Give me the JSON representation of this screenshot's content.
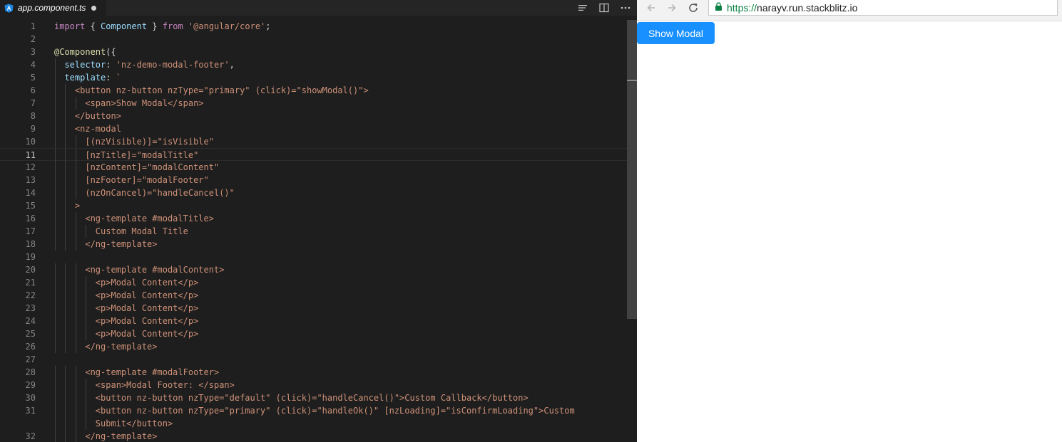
{
  "editor": {
    "tab": {
      "filename": "app.component.ts",
      "file_icon": "angular-icon",
      "dirty": true
    },
    "actions": [
      "outline-icon",
      "split-editor-icon",
      "more-icon"
    ],
    "lines": [
      {
        "n": "1",
        "tokens": [
          [
            "import",
            "kw"
          ],
          [
            " { ",
            "plain"
          ],
          [
            "Component",
            "cls"
          ],
          [
            " } ",
            "plain"
          ],
          [
            "from",
            "kw"
          ],
          [
            " ",
            "plain"
          ],
          [
            "'@angular/core'",
            "str"
          ],
          [
            ";",
            "plain"
          ]
        ]
      },
      {
        "n": "2",
        "tokens": []
      },
      {
        "n": "3",
        "tokens": [
          [
            "@Component",
            "dec"
          ],
          [
            "({",
            "plain"
          ]
        ]
      },
      {
        "n": "4",
        "tokens": [
          [
            "  ",
            "plain"
          ],
          [
            "selector",
            "cls"
          ],
          [
            ": ",
            "plain"
          ],
          [
            "'nz-demo-modal-footer'",
            "str"
          ],
          [
            ",",
            "plain"
          ]
        ]
      },
      {
        "n": "5",
        "tokens": [
          [
            "  ",
            "plain"
          ],
          [
            "template",
            "cls"
          ],
          [
            ": ",
            "plain"
          ],
          [
            "`",
            "str"
          ]
        ]
      },
      {
        "n": "6",
        "tokens": [
          [
            "    <button nz-button nzType=\"primary\" (click)=\"showModal()\">",
            "str"
          ]
        ]
      },
      {
        "n": "7",
        "tokens": [
          [
            "      <span>Show Modal</span>",
            "str"
          ]
        ]
      },
      {
        "n": "8",
        "tokens": [
          [
            "    </button>",
            "str"
          ]
        ]
      },
      {
        "n": "9",
        "tokens": [
          [
            "    <nz-modal",
            "str"
          ]
        ]
      },
      {
        "n": "10",
        "tokens": [
          [
            "      [(nzVisible)]=\"isVisible\"",
            "str"
          ]
        ]
      },
      {
        "n": "11",
        "tokens": [
          [
            "      [nzTitle]=\"modalTitle\"",
            "str"
          ]
        ],
        "current": true
      },
      {
        "n": "12",
        "tokens": [
          [
            "      [nzContent]=\"modalContent\"",
            "str"
          ]
        ]
      },
      {
        "n": "13",
        "tokens": [
          [
            "      [nzFooter]=\"modalFooter\"",
            "str"
          ]
        ]
      },
      {
        "n": "14",
        "tokens": [
          [
            "      (nzOnCancel)=\"handleCancel()\"",
            "str"
          ]
        ]
      },
      {
        "n": "15",
        "tokens": [
          [
            "    >",
            "str"
          ]
        ]
      },
      {
        "n": "16",
        "tokens": [
          [
            "      <ng-template #modalTitle>",
            "str"
          ]
        ]
      },
      {
        "n": "17",
        "tokens": [
          [
            "        Custom Modal Title",
            "str"
          ]
        ]
      },
      {
        "n": "18",
        "tokens": [
          [
            "      </ng-template>",
            "str"
          ]
        ]
      },
      {
        "n": "19",
        "tokens": []
      },
      {
        "n": "20",
        "tokens": [
          [
            "      <ng-template #modalContent>",
            "str"
          ]
        ]
      },
      {
        "n": "21",
        "tokens": [
          [
            "        <p>Modal Content</p>",
            "str"
          ]
        ]
      },
      {
        "n": "22",
        "tokens": [
          [
            "        <p>Modal Content</p>",
            "str"
          ]
        ]
      },
      {
        "n": "23",
        "tokens": [
          [
            "        <p>Modal Content</p>",
            "str"
          ]
        ]
      },
      {
        "n": "24",
        "tokens": [
          [
            "        <p>Modal Content</p>",
            "str"
          ]
        ]
      },
      {
        "n": "25",
        "tokens": [
          [
            "        <p>Modal Content</p>",
            "str"
          ]
        ]
      },
      {
        "n": "26",
        "tokens": [
          [
            "      </ng-template>",
            "str"
          ]
        ]
      },
      {
        "n": "27",
        "tokens": []
      },
      {
        "n": "28",
        "tokens": [
          [
            "      <ng-template #modalFooter>",
            "str"
          ]
        ]
      },
      {
        "n": "29",
        "tokens": [
          [
            "        <span>Modal Footer: </span>",
            "str"
          ]
        ]
      },
      {
        "n": "30",
        "tokens": [
          [
            "        <button nz-button nzType=\"default\" (click)=\"handleCancel()\">Custom Callback</button>",
            "str"
          ]
        ]
      },
      {
        "n": "31",
        "tokens": [
          [
            "        <button nz-button nzType=\"primary\" (click)=\"handleOk()\" [nzLoading]=\"isConfirmLoading\">Custom",
            "str"
          ]
        ]
      },
      {
        "n": "",
        "tokens": [
          [
            "        Submit</button>",
            "str"
          ]
        ]
      },
      {
        "n": "32",
        "tokens": [
          [
            "      </ng-template>",
            "str"
          ]
        ]
      }
    ]
  },
  "browser": {
    "nav": [
      "back-icon",
      "forward-icon",
      "reload-icon"
    ],
    "url": {
      "scheme": "https://",
      "host": "narayv.run.stackblitz.io",
      "secure_icon": "lock-icon"
    },
    "show_modal_label": "Show Modal",
    "colors": {
      "primary": "#1890ff",
      "secure": "#0b8043"
    }
  }
}
